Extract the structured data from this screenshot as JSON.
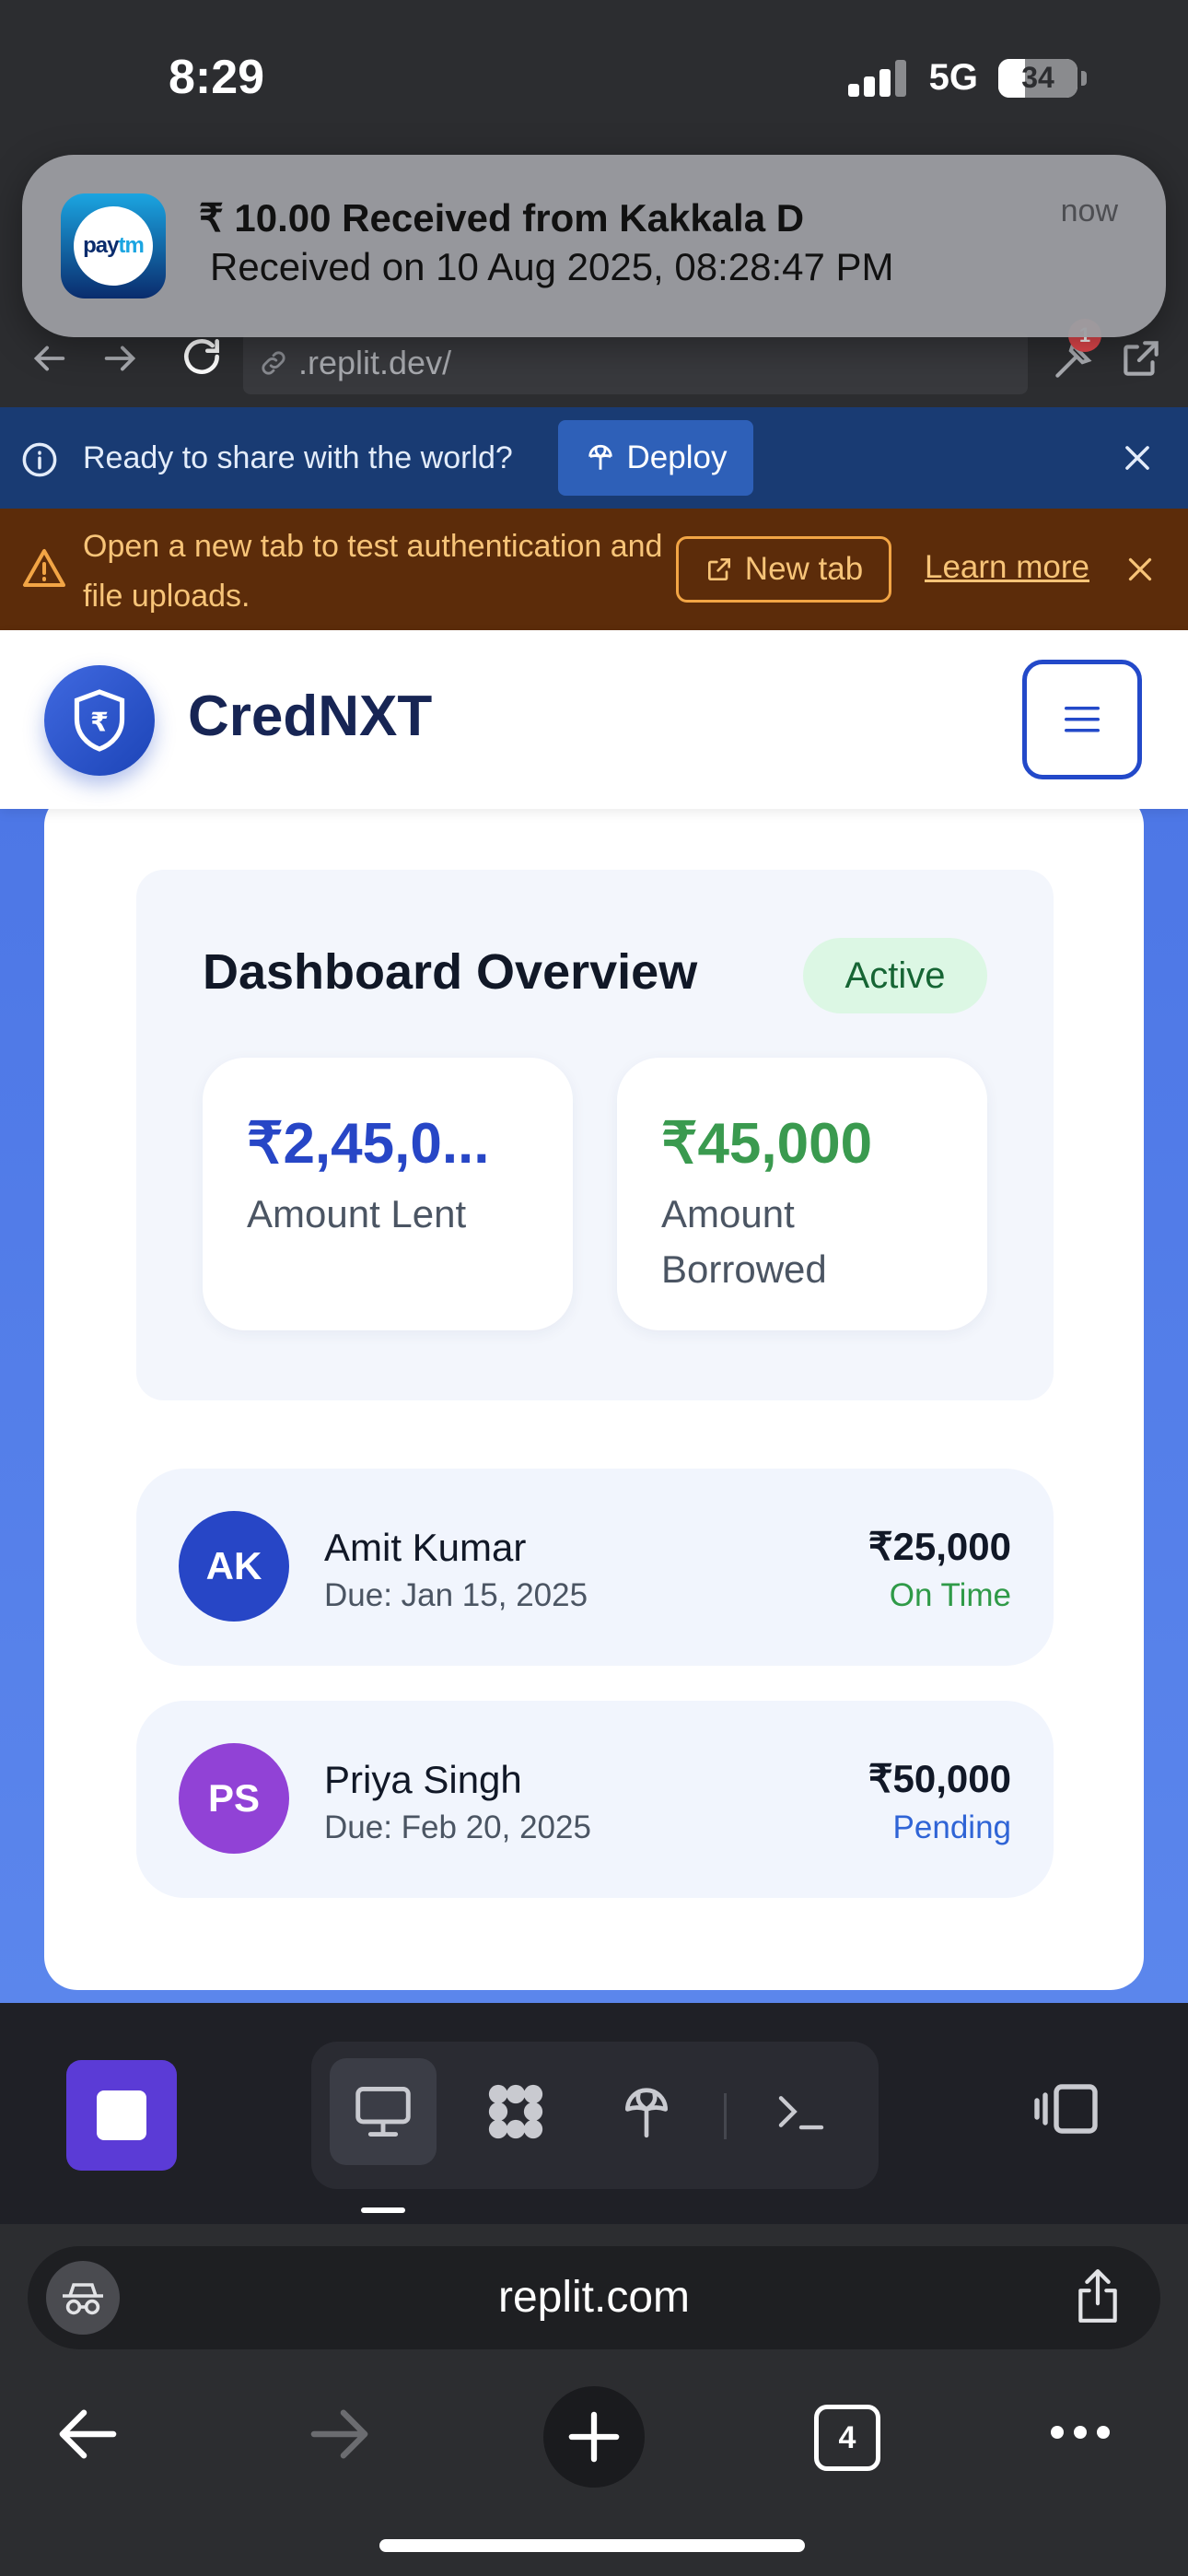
{
  "status_bar": {
    "time": "8:29",
    "network": "5G",
    "battery": "34",
    "battery_level": 0.34
  },
  "notification": {
    "app": "Paytm",
    "icon_text_a": "pay",
    "icon_text_b": "tm",
    "title": "₹ 10.00 Received from Kakkala D",
    "body": "Received on 10 Aug 2025, 08:28:47 PM",
    "time": "now"
  },
  "browser": {
    "url": ".replit.dev/",
    "badge_count": "1"
  },
  "deploy_banner": {
    "text": "Ready to share with the world?",
    "button": "Deploy"
  },
  "auth_banner": {
    "text": "Open a new tab to test authentication and file uploads.",
    "new_tab": "New tab",
    "learn_more": "Learn more"
  },
  "app": {
    "brand": "CredNXT",
    "logo_symbol": "₹"
  },
  "overview": {
    "title": "Dashboard Overview",
    "status": "Active",
    "stats": [
      {
        "value": "₹2,45,0...",
        "label": "Amount Lent",
        "color": "#2746c6"
      },
      {
        "value": "₹45,000",
        "label": "Amount Borrowed",
        "color": "#3a9a4f"
      }
    ]
  },
  "loans": [
    {
      "initials": "AK",
      "name": "Amit Kumar",
      "due": "Due: Jan 15, 2025",
      "amount": "₹25,000",
      "status": "On Time",
      "avatar_color": "#2746c6",
      "status_color": "#2f9a48"
    },
    {
      "initials": "PS",
      "name": "Priya Singh",
      "due": "Due: Feb 20, 2025",
      "amount": "₹50,000",
      "status": "Pending",
      "avatar_color": "#9142d6",
      "status_color": "#2f64d6"
    }
  ],
  "safari": {
    "address": "replit.com",
    "tab_count": "4"
  }
}
